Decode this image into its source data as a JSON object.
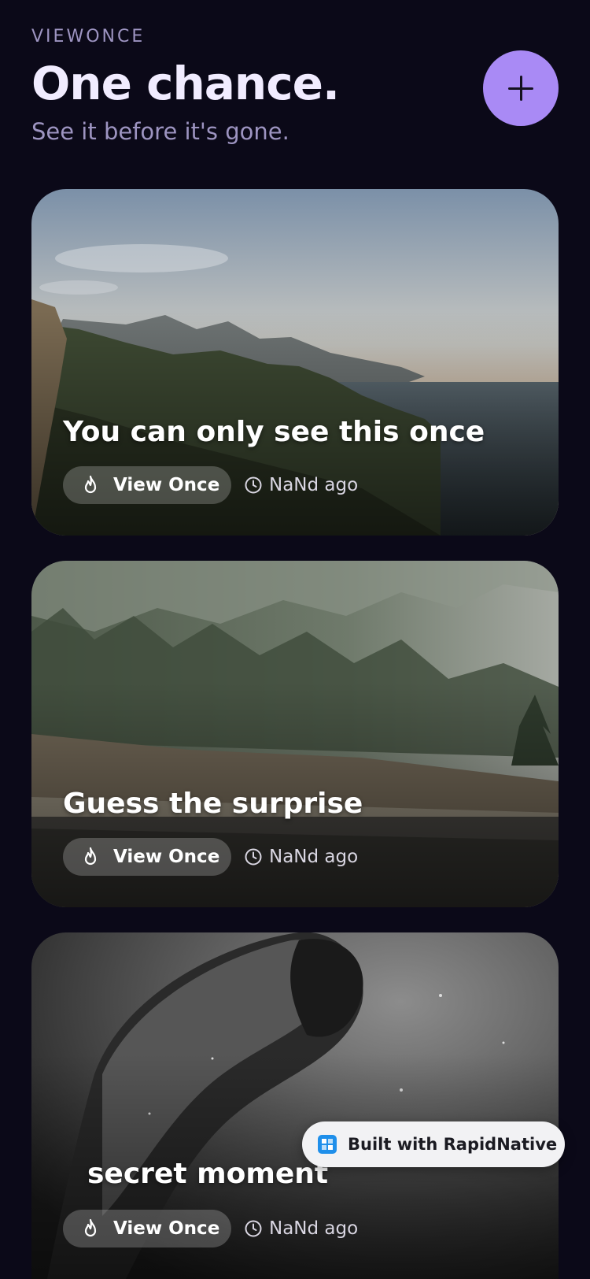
{
  "header": {
    "eyebrow": "VIEWONCE",
    "title": "One chance.",
    "subtitle": "See it before it's gone.",
    "add_button_icon": "plus-icon"
  },
  "colors": {
    "background": "#0b0918",
    "accent": "#a98af5",
    "muted_text": "#9d94c1"
  },
  "cards": [
    {
      "title": "You can only see this once",
      "badge_label": "View Once",
      "badge_icon": "flame-icon",
      "time_icon": "clock-icon",
      "time": "NaNd ago",
      "image": "coastal cliffs and sea at sunset"
    },
    {
      "title": "Guess the surprise",
      "badge_label": "View Once",
      "badge_icon": "flame-icon",
      "time_icon": "clock-icon",
      "time": "NaNd ago",
      "image": "misty pine forest and rocky riverbank"
    },
    {
      "title": "secret moment",
      "badge_label": "View Once",
      "badge_icon": "flame-icon",
      "time_icon": "clock-icon",
      "time": "NaNd ago",
      "image": "black and white person underwater"
    }
  ],
  "watermark": {
    "label": "Built with RapidNative"
  }
}
